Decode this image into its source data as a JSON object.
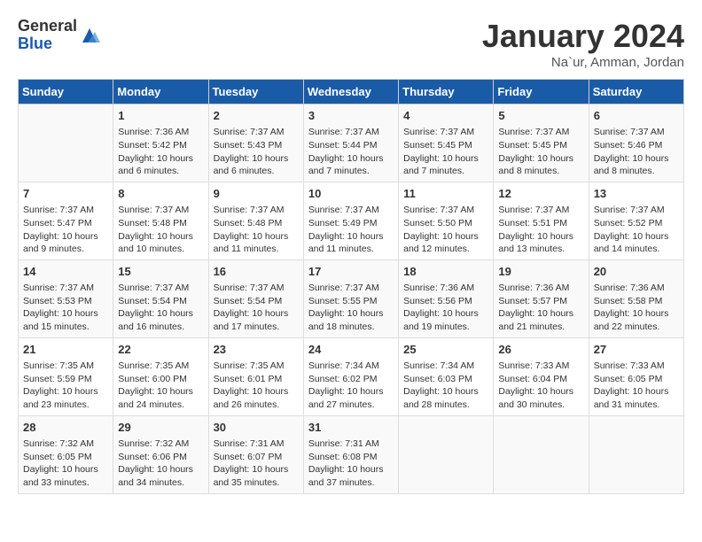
{
  "header": {
    "logo_general": "General",
    "logo_blue": "Blue",
    "month_title": "January 2024",
    "location": "Na`ur, Amman, Jordan"
  },
  "days_of_week": [
    "Sunday",
    "Monday",
    "Tuesday",
    "Wednesday",
    "Thursday",
    "Friday",
    "Saturday"
  ],
  "weeks": [
    [
      {
        "day": "",
        "info": ""
      },
      {
        "day": "1",
        "info": "Sunrise: 7:36 AM\nSunset: 5:42 PM\nDaylight: 10 hours\nand 6 minutes."
      },
      {
        "day": "2",
        "info": "Sunrise: 7:37 AM\nSunset: 5:43 PM\nDaylight: 10 hours\nand 6 minutes."
      },
      {
        "day": "3",
        "info": "Sunrise: 7:37 AM\nSunset: 5:44 PM\nDaylight: 10 hours\nand 7 minutes."
      },
      {
        "day": "4",
        "info": "Sunrise: 7:37 AM\nSunset: 5:45 PM\nDaylight: 10 hours\nand 7 minutes."
      },
      {
        "day": "5",
        "info": "Sunrise: 7:37 AM\nSunset: 5:45 PM\nDaylight: 10 hours\nand 8 minutes."
      },
      {
        "day": "6",
        "info": "Sunrise: 7:37 AM\nSunset: 5:46 PM\nDaylight: 10 hours\nand 8 minutes."
      }
    ],
    [
      {
        "day": "7",
        "info": "Sunrise: 7:37 AM\nSunset: 5:47 PM\nDaylight: 10 hours\nand 9 minutes."
      },
      {
        "day": "8",
        "info": "Sunrise: 7:37 AM\nSunset: 5:48 PM\nDaylight: 10 hours\nand 10 minutes."
      },
      {
        "day": "9",
        "info": "Sunrise: 7:37 AM\nSunset: 5:48 PM\nDaylight: 10 hours\nand 11 minutes."
      },
      {
        "day": "10",
        "info": "Sunrise: 7:37 AM\nSunset: 5:49 PM\nDaylight: 10 hours\nand 11 minutes."
      },
      {
        "day": "11",
        "info": "Sunrise: 7:37 AM\nSunset: 5:50 PM\nDaylight: 10 hours\nand 12 minutes."
      },
      {
        "day": "12",
        "info": "Sunrise: 7:37 AM\nSunset: 5:51 PM\nDaylight: 10 hours\nand 13 minutes."
      },
      {
        "day": "13",
        "info": "Sunrise: 7:37 AM\nSunset: 5:52 PM\nDaylight: 10 hours\nand 14 minutes."
      }
    ],
    [
      {
        "day": "14",
        "info": "Sunrise: 7:37 AM\nSunset: 5:53 PM\nDaylight: 10 hours\nand 15 minutes."
      },
      {
        "day": "15",
        "info": "Sunrise: 7:37 AM\nSunset: 5:54 PM\nDaylight: 10 hours\nand 16 minutes."
      },
      {
        "day": "16",
        "info": "Sunrise: 7:37 AM\nSunset: 5:54 PM\nDaylight: 10 hours\nand 17 minutes."
      },
      {
        "day": "17",
        "info": "Sunrise: 7:37 AM\nSunset: 5:55 PM\nDaylight: 10 hours\nand 18 minutes."
      },
      {
        "day": "18",
        "info": "Sunrise: 7:36 AM\nSunset: 5:56 PM\nDaylight: 10 hours\nand 19 minutes."
      },
      {
        "day": "19",
        "info": "Sunrise: 7:36 AM\nSunset: 5:57 PM\nDaylight: 10 hours\nand 21 minutes."
      },
      {
        "day": "20",
        "info": "Sunrise: 7:36 AM\nSunset: 5:58 PM\nDaylight: 10 hours\nand 22 minutes."
      }
    ],
    [
      {
        "day": "21",
        "info": "Sunrise: 7:35 AM\nSunset: 5:59 PM\nDaylight: 10 hours\nand 23 minutes."
      },
      {
        "day": "22",
        "info": "Sunrise: 7:35 AM\nSunset: 6:00 PM\nDaylight: 10 hours\nand 24 minutes."
      },
      {
        "day": "23",
        "info": "Sunrise: 7:35 AM\nSunset: 6:01 PM\nDaylight: 10 hours\nand 26 minutes."
      },
      {
        "day": "24",
        "info": "Sunrise: 7:34 AM\nSunset: 6:02 PM\nDaylight: 10 hours\nand 27 minutes."
      },
      {
        "day": "25",
        "info": "Sunrise: 7:34 AM\nSunset: 6:03 PM\nDaylight: 10 hours\nand 28 minutes."
      },
      {
        "day": "26",
        "info": "Sunrise: 7:33 AM\nSunset: 6:04 PM\nDaylight: 10 hours\nand 30 minutes."
      },
      {
        "day": "27",
        "info": "Sunrise: 7:33 AM\nSunset: 6:05 PM\nDaylight: 10 hours\nand 31 minutes."
      }
    ],
    [
      {
        "day": "28",
        "info": "Sunrise: 7:32 AM\nSunset: 6:05 PM\nDaylight: 10 hours\nand 33 minutes."
      },
      {
        "day": "29",
        "info": "Sunrise: 7:32 AM\nSunset: 6:06 PM\nDaylight: 10 hours\nand 34 minutes."
      },
      {
        "day": "30",
        "info": "Sunrise: 7:31 AM\nSunset: 6:07 PM\nDaylight: 10 hours\nand 35 minutes."
      },
      {
        "day": "31",
        "info": "Sunrise: 7:31 AM\nSunset: 6:08 PM\nDaylight: 10 hours\nand 37 minutes."
      },
      {
        "day": "",
        "info": ""
      },
      {
        "day": "",
        "info": ""
      },
      {
        "day": "",
        "info": ""
      }
    ]
  ]
}
